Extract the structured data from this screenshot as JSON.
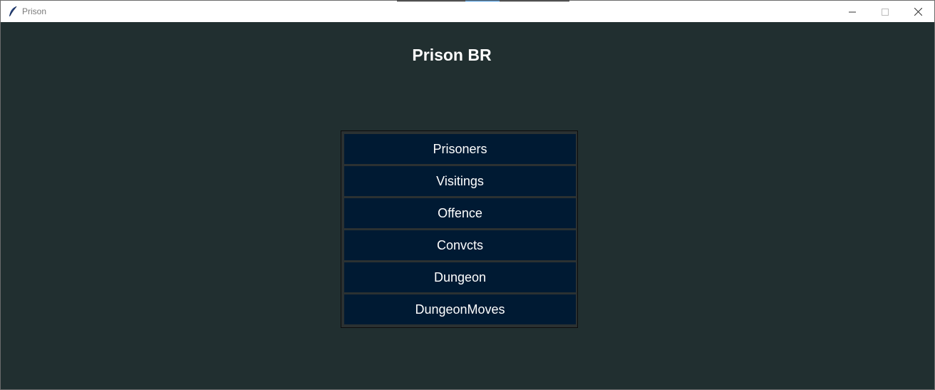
{
  "window": {
    "title": "Prison",
    "controls": [
      "minimize-icon",
      "maximize-icon",
      "close-icon"
    ],
    "app_icon": "feather-icon"
  },
  "page": {
    "title": "Prison BR"
  },
  "menu": {
    "items": [
      {
        "label": "Prisoners"
      },
      {
        "label": "Visitings"
      },
      {
        "label": "Offence"
      },
      {
        "label": "Convcts"
      },
      {
        "label": "Dungeon"
      },
      {
        "label": "DungeonMoves"
      }
    ]
  },
  "colors": {
    "background": "#212f30",
    "button": "#001a33",
    "button_text": "#ffffff",
    "title_text": "#ffffff"
  }
}
